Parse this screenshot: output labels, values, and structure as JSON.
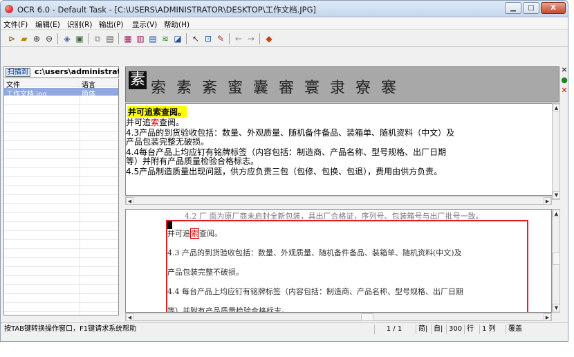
{
  "window": {
    "title": "OCR 6.0 - Default Task - [C:\\USERS\\ADMINISTRATOR\\DESKTOP\\工作文档.JPG]",
    "min_label": "▁",
    "max_label": "□",
    "close_label": "X"
  },
  "menu": [
    "文件(F)",
    "编辑(E)",
    "识别(R)",
    "输出(P)",
    "显示(V)",
    "帮助(H)"
  ],
  "toolbar_icons": [
    "open-folder-icon",
    "open-file-icon",
    "zoom-in-icon",
    "zoom-out-icon",
    "scan-icon",
    "image-icon",
    "copy-icon",
    "paste-icon",
    "layout-1-icon",
    "layout-2-icon",
    "layout-3-icon",
    "recognize-icon",
    "select-icon",
    "pointer-icon",
    "window-icon",
    "pen-icon",
    "back-arrow-icon",
    "forward-arrow-icon",
    "color-icon"
  ],
  "left_panel": {
    "scan_button": "扫描到",
    "scan_path": "c:\\users\\administrator",
    "col_file": "文件",
    "col_lang": "语言",
    "files": [
      {
        "name": "工作文档.jpg",
        "lang": "简体"
      }
    ]
  },
  "strip": {
    "first_char": "素",
    "chars": "索 素 紊 蜜  囊 審 寰 隶  寮 褰"
  },
  "result": {
    "head": "并可追索查阅。",
    "line1_pre": "并可追",
    "line1_red": "索",
    "line1_post": "查阅。",
    "lines": [
      "    4.3产品的到货验收包括：数量、外观质量、随机备件备品、装箱单、随机资料（中文）及",
      "产品包装完整无破损。",
      "    4.4每台产品上均应钉有铭牌标签（内容包括：制造商、产品名称、型号规格、出厂日期",
      "等）并附有产品质量检验合格标志。",
      "    4.5产品制造质量出现问题，供方应负责三包（包修、包换、包退），费用由供方负责。"
    ]
  },
  "image_view": {
    "top_cut": "4.2 厂 面为原厂商未启封全新包装，具出厂合格证，序列号、包装箱号与出厂批号一致。",
    "l1_pre": "并可追",
    "l1_red": "索",
    "l1_post": "查阅。",
    "l2": "    4.3 产品的到货验收包括：数量、外观质量、随机备件备品、装箱单、随机资料(中文)及",
    "l3": "产品包装完整不破损。",
    "l4": "    4.4 每台产品上均应钉有铭牌标签（内容包括：制造商、产品名称、型号规格、出厂日期",
    "l5": "等）并附有产品质量检验合格标志。"
  },
  "status": {
    "hint": "按TAB键转换操作窗口，F1键请求系统帮助",
    "page": "1 / 1",
    "s1": "简|",
    "s2": "自|",
    "s3": "300",
    "s4": "行",
    "s5": "1 列",
    "s6": "覆盖"
  }
}
